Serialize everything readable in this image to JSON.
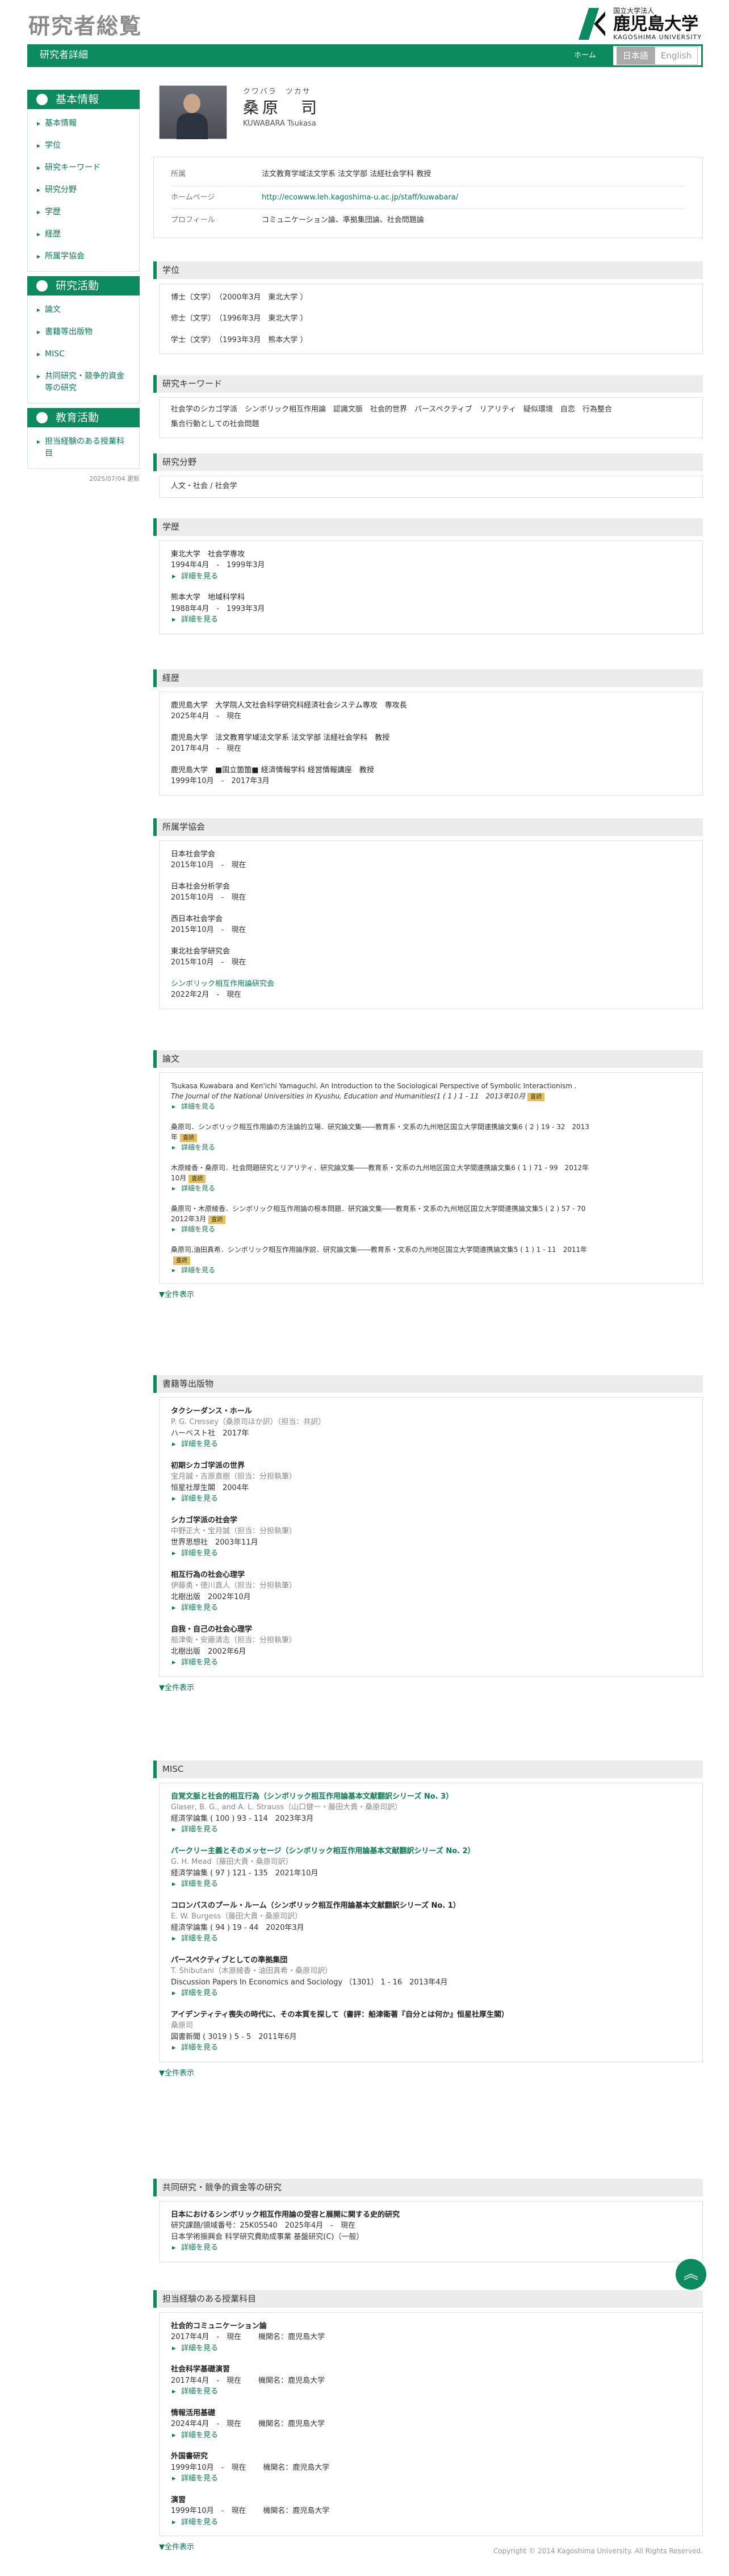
{
  "header": {
    "site_title": "研究者総覧",
    "logo_small": "国立大学法人",
    "logo_big": "鹿児島大学",
    "logo_en": "KAGOSHIMA UNIVERSITY"
  },
  "bar": {
    "title": "研究者詳細",
    "home": "ホーム",
    "lang_ja": "日本語",
    "lang_en": "English"
  },
  "sidebar": {
    "basic_title": "基本情報",
    "basic_items": [
      "基本情報",
      "学位",
      "研究キーワード",
      "研究分野",
      "学歴",
      "経歴",
      "所属学協会"
    ],
    "research_title": "研究活動",
    "research_items": [
      "論文",
      "書籍等出版物",
      "MISC",
      "共同研究・競争的資金等の研究"
    ],
    "edu_title": "教育活動",
    "edu_items": [
      "担当経験のある授業科目"
    ],
    "updated": "2025/07/04 更新"
  },
  "profile": {
    "kana": "クワバラ　ツカサ",
    "name": "桑原　司",
    "name_en": "KUWABARA Tsukasa",
    "affil_label": "所属",
    "affil": "法文教育学域法文学系 法文学部 法経社会学科 教授",
    "home_label": "ホームページ",
    "home": "http://ecowww.leh.kagoshima-u.ac.jp/staff/kuwabara/",
    "profile_label": "プロフィール",
    "profile": "コミュニケーション論、準拠集団論、社会問題論"
  },
  "degree": {
    "title": "学位",
    "items": [
      "博士（文学）　（2000年3月　東北大学 ）",
      "修士（文学）　（1996年3月　東北大学 ）",
      "学士（文学）　（1993年3月　熊本大学 ）"
    ]
  },
  "keywords": {
    "title": "研究キーワード",
    "text1": "社会学のシカゴ学派　シンボリック相互作用論　認識文脈　社会的世界　パースペクティブ　リアリティ　疑似環境　自恋　行為整合",
    "text2": "集合行動としての社会問題"
  },
  "field": {
    "title": "研究分野",
    "text": "人文・社会 / 社会学"
  },
  "education": {
    "title": "学歴",
    "detail": "詳細を見る",
    "items": [
      {
        "t": "東北大学　社会学専攻",
        "d": "1994年4月　-　1999年3月"
      },
      {
        "t": "熊本大学　地域科学科",
        "d": "1988年4月　-　1993年3月"
      }
    ]
  },
  "career": {
    "title": "経歴",
    "items": [
      {
        "t": "鹿児島大学　大学院人文社会科学研究科経済社会システム専攻　専攻長",
        "d": "2025年4月　-　現在"
      },
      {
        "t": "鹿児島大学　法文教育学域法文学系 法文学部 法経社会学科　教授",
        "d": "2017年4月　-　現在"
      },
      {
        "t": "鹿児島大学　■国立箇箇■ 経済情報学科 経営情報講座　教授",
        "d": "1999年10月　-　2017年3月"
      }
    ]
  },
  "societies": {
    "title": "所属学協会",
    "items": [
      {
        "t": "日本社会学会",
        "d": "2015年10月　-　現在"
      },
      {
        "t": "日本社会分析学会",
        "d": "2015年10月　-　現在"
      },
      {
        "t": "西日本社会学会",
        "d": "2015年10月　-　現在"
      },
      {
        "t": "東北社会学研究会",
        "d": "2015年10月　-　現在"
      },
      {
        "t": "シンボリック相互作用論研究会",
        "d": "2022年2月　-　現在"
      }
    ]
  },
  "papers": {
    "title": "論文",
    "detail": "詳細を見る",
    "all": "▼全件表示",
    "tag": "査読",
    "items": [
      {
        "l1": "Tsukasa Kuwabara and Ken'ichi Yamaguchi.  An Introduction to the Sociological Perspective of Symbolic Interactionism .",
        "l2": "The Journal of the National Universities in Kyushu, Education and Humanities(1 ( 1 ) 1 - 11　2013年10月"
      },
      {
        "l1": "桑原司．シンボリック相互作用論の方法論的立場．研究論文集――教育系・文系の九州地区国立大学間連携論文集6 ( 2 ) 19 - 32　2013",
        "l2": "年"
      },
      {
        "l1": "木原綾香・桑原司．社会問題研究とリアリティ．研究論文集――教育系・文系の九州地区国立大学間連携論文集6 ( 1 ) 71 - 99　2012年",
        "l2": "10月"
      },
      {
        "l1": "桑原司・木原綾香．シンボリック相互作用論の根本問題．研究論文集――教育系・文系の九州地区国立大学間連携論文集5 ( 2 ) 57 - 70",
        "l2": "2012年3月"
      },
      {
        "l1": "桑原司,油田真希．シンボリック相互作用論序説．研究論文集――教育系・文系の九州地区国立大学間連携論文集5 ( 1 ) 1 - 11　2011年",
        "l2": ""
      }
    ]
  },
  "books": {
    "title": "書籍等出版物",
    "detail": "詳細を見る",
    "all": "▼全件表示",
    "items": [
      {
        "t": "タクシーダンス・ホール",
        "a": "P. G. Cressey（桑原司ほか訳）（担当：共訳）",
        "p": "ハーベスト社　2017年"
      },
      {
        "t": "初期シカゴ学派の世界",
        "a": "宝月誠・吉原直樹（担当：分担執筆）",
        "p": "恒星社厚生閣　2004年"
      },
      {
        "t": "シカゴ学派の社会学",
        "a": "中野正大・宝月誠（担当：分担執筆）",
        "p": "世界思想社　2003年11月"
      },
      {
        "t": "相互行為の社会心理学",
        "a": "伊藤勇・徳川直人（担当：分担執筆）",
        "p": "北樹出版　2002年10月"
      },
      {
        "t": "自我・自己の社会心理学",
        "a": "船津衛・安藤清志（担当：分担執筆）",
        "p": "北樹出版　2002年6月"
      }
    ]
  },
  "misc": {
    "title": "MISC",
    "detail": "詳細を見る",
    "all": "▼全件表示",
    "items": [
      {
        "t": "自覚文脈と社会的相互行為（シンボリック相互作用論基本文献翻訳シリーズ No. 3）",
        "a": "Glaser, B. G., and A. L. Strauss（山口健一・藤田大貴・桑原司訳）",
        "p": "経済学論集 ( 100 )  93 - 114　2023年3月",
        "g": true
      },
      {
        "t": "パークリー主義とそのメッセージ（シンボリック相互作用論基本文献翻訳シリーズ No. 2）",
        "a": "G. H. Mead（藤田大貴・桑原司訳）",
        "p": "経済学論集 ( 97 )  121 - 135　2021年10月",
        "g": true
      },
      {
        "t": "コロンバスのプール・ルーム（シンボリック相互作用論基本文献翻訳シリーズ No. 1）",
        "a": "E. W. Burgess（藤田大貴・桑原司訳）",
        "p": "経済学論集 ( 94 )  19 - 44　2020年3月",
        "g": false
      },
      {
        "t": "パースペクティブとしての準拠集団",
        "a": "T. Shibutani（木原綾香・油田真希・桑原司訳）",
        "p": "Discussion Papers In Economics and Sociology （1301） 1 - 16　2013年4月",
        "g": false
      },
      {
        "t": "アイデンティティ喪失の時代に、その本質を探して（書評：船津衛著『自分とは何か』恒星社厚生閣）",
        "a": "桑原司",
        "p": "図書新聞 ( 3019 )  5 - 5　2011年6月",
        "g": false
      }
    ]
  },
  "grants": {
    "title": "共同研究・競争的資金等の研究",
    "detail": "詳細を見る",
    "items": [
      {
        "t": "日本におけるシンボリック相互作用論の受容と展開に関する史的研究",
        "a": "研究課題/領域番号：25K05540　2025年4月　-　現在",
        "p": "日本学術振興会  科学研究費助成事業  基盤研究(C)（一般）"
      }
    ]
  },
  "courses": {
    "title": "担当経験のある授業科目",
    "detail": "詳細を見る",
    "all": "▼全件表示",
    "org_label": "機関名：",
    "items": [
      {
        "t": "社会的コミュニケーション論",
        "d": "2017年4月　-　現在",
        "o": "鹿児島大学"
      },
      {
        "t": "社会科学基礎演習",
        "d": "2017年4月　-　現在",
        "o": "鹿児島大学"
      },
      {
        "t": "情報活用基礎",
        "d": "2024年4月　-　現在",
        "o": "鹿児島大学"
      },
      {
        "t": "外国書研究",
        "d": "1999年10月　-　現在",
        "o": "鹿児島大学"
      },
      {
        "t": "演習",
        "d": "1999年10月　-　現在",
        "o": "鹿児島大学"
      }
    ]
  },
  "footer": {
    "copyright": "Copyright © 2014 Kagoshima University. All Rights Reserved."
  },
  "colors": {
    "brand": "#0b8a5e",
    "link": "#0a7a55",
    "tag": "#e6c15a"
  }
}
